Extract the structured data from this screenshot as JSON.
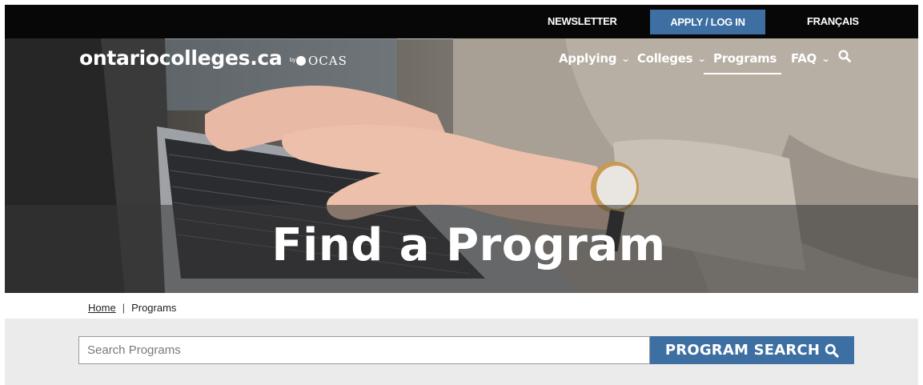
{
  "topbar": {
    "newsletter": "NEWSLETTER",
    "apply": "APPLY / LOG IN",
    "language": "FRANÇAIS"
  },
  "brand": {
    "logo_text": "ontariocolleges.ca",
    "by": "by",
    "partner": "OCAS"
  },
  "nav": {
    "items": [
      {
        "label": "Applying",
        "has_dropdown": true
      },
      {
        "label": "Colleges",
        "has_dropdown": true
      },
      {
        "label": "Programs",
        "has_dropdown": false,
        "active": true
      },
      {
        "label": "FAQ",
        "has_dropdown": true
      }
    ],
    "search_icon": "search-icon"
  },
  "hero": {
    "title": "Find a Program"
  },
  "breadcrumb": {
    "home": "Home",
    "separator": "|",
    "current": "Programs"
  },
  "search": {
    "placeholder": "Search Programs",
    "value": "",
    "button_label": "PROGRAM SEARCH",
    "button_icon": "search-icon"
  },
  "colors": {
    "accent": "#3d6fa2",
    "topbar": "#070707",
    "search_band": "#ebebeb"
  }
}
